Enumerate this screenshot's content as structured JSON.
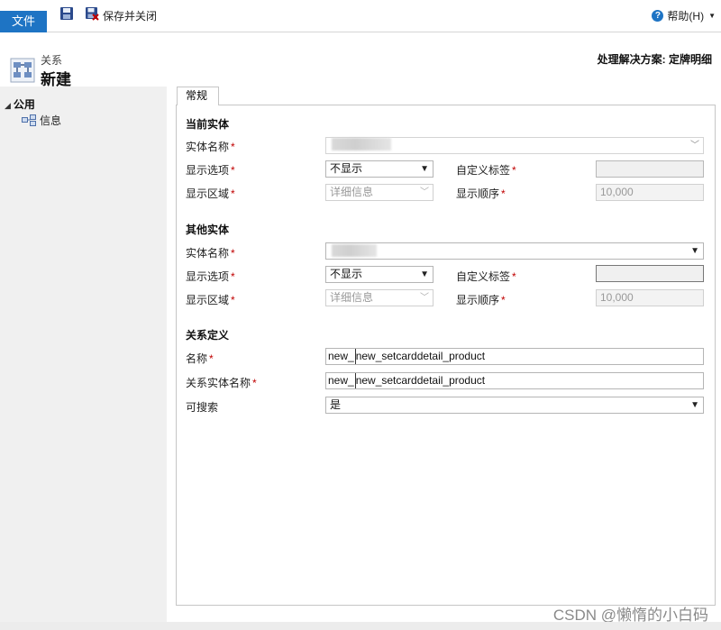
{
  "ribbon": {
    "file_label": "文件",
    "save_close_label": "保存并关闭",
    "help_label": "帮助(H)"
  },
  "header": {
    "entity_type": "关系",
    "title": "新建",
    "solution_label": "处理解决方案: 定牌明细"
  },
  "nav": {
    "group_label": "公用",
    "item_label": "信息"
  },
  "tab_label": "常规",
  "current_entity": {
    "section_label": "当前实体",
    "entity_name_label": "实体名称",
    "display_option_label": "显示选项",
    "display_option_value": "不显示",
    "custom_label_label": "自定义标签",
    "display_area_label": "显示区域",
    "display_area_value": "详细信息",
    "display_order_label": "显示顺序",
    "display_order_value": "10,000"
  },
  "other_entity": {
    "section_label": "其他实体",
    "entity_name_label": "实体名称",
    "display_option_label": "显示选项",
    "display_option_value": "不显示",
    "custom_label_label": "自定义标签",
    "display_area_label": "显示区域",
    "display_area_value": "详细信息",
    "display_order_label": "显示顺序",
    "display_order_value": "10,000"
  },
  "relationship": {
    "section_label": "关系定义",
    "name_label": "名称",
    "name_prefix": "new_",
    "name_value": "new_setcarddetail_product",
    "rel_entity_label": "关系实体名称",
    "rel_entity_prefix": "new_",
    "rel_entity_value": "new_setcarddetail_product",
    "searchable_label": "可搜索",
    "searchable_value": "是"
  },
  "required_mark": "*",
  "watermark": "CSDN @懒惰的小白码",
  "colors": {
    "accent": "#1e74c4",
    "required": "#c00000"
  }
}
